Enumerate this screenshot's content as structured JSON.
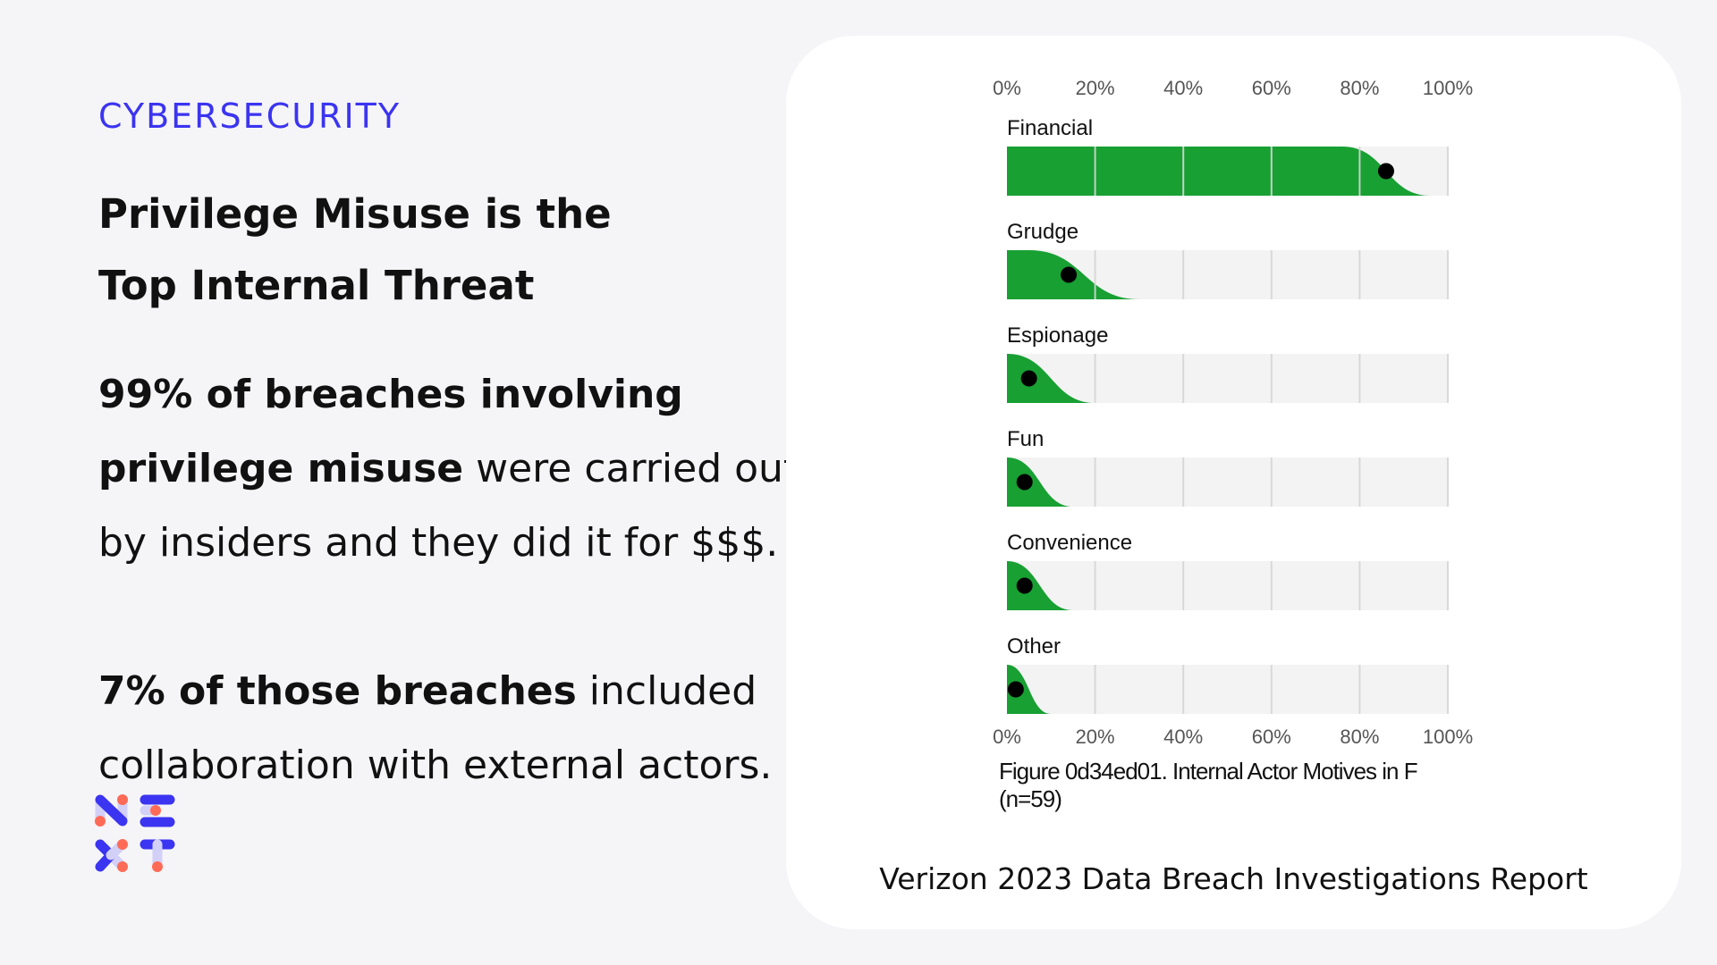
{
  "header": {
    "kicker": "CYBERSECURITY",
    "title_line1": "Privilege Misuse is the",
    "title_line2": "Top Internal Threat"
  },
  "body": {
    "p1_bold": "99% of breaches involving",
    "p1_bold2": "privilege misuse",
    "p1_rest": " were carried out",
    "p1_line3": "by insiders and they did it for $$$.",
    "p2_bold": "7% of those breaches",
    "p2_rest": " included",
    "p2_line2": "collaboration with external actors."
  },
  "logo": {
    "text": "NEXT",
    "colors": {
      "primary": "#3b34f0",
      "light": "#d2d0f7",
      "dot": "#ff6b57"
    }
  },
  "chart_data": {
    "type": "bar",
    "subtype": "distribution-with-point-estimate",
    "xlim": [
      0,
      100
    ],
    "ticks": [
      "0%",
      "20%",
      "40%",
      "60%",
      "80%",
      "100%"
    ],
    "tick_values": [
      0,
      20,
      40,
      60,
      80,
      100
    ],
    "grid": true,
    "categories": [
      "Financial",
      "Grudge",
      "Espionage",
      "Fun",
      "Convenience",
      "Other"
    ],
    "values": [
      86,
      14,
      5,
      4,
      4,
      2
    ],
    "distribution_ranges": [
      [
        76,
        96
      ],
      [
        5,
        30
      ],
      [
        0,
        20
      ],
      [
        0,
        15
      ],
      [
        0,
        15
      ],
      [
        0,
        10
      ]
    ],
    "colors": {
      "fill": "#18a033",
      "track": "#f3f3f3",
      "grid": "#d6d6d6",
      "point": "#000000"
    },
    "caption_line1": "Figure 0d34ed01. Internal Actor Motives in F",
    "caption_line2": "(n=59)"
  },
  "footer": {
    "source": "Verizon 2023 Data Breach Investigations Report"
  }
}
